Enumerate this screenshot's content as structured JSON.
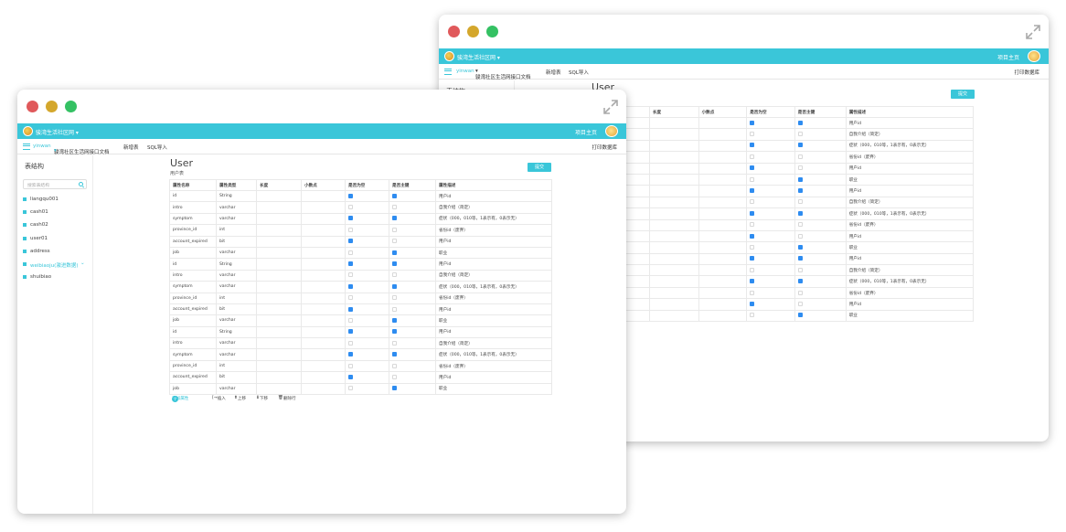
{
  "app": {
    "community": "骏湾生活社区网",
    "home": "项目主页"
  },
  "toolbar": {
    "user": "yinwan",
    "project": "骏湾社区生活网接口文档",
    "new_table": "新增表",
    "sql_import": "SQL导入",
    "print": "打印数据库"
  },
  "sidebar": {
    "title": "表结构",
    "search_placeholder": "搜索表结构",
    "items": [
      {
        "label": "liangqu001"
      },
      {
        "label": "cash01"
      },
      {
        "label": "cash02"
      },
      {
        "label": "user01"
      },
      {
        "label": "address"
      },
      {
        "label": "weibiaoju(激进数据)"
      },
      {
        "label": "shuibiao"
      }
    ]
  },
  "main": {
    "title": "User",
    "subtitle": "用户表",
    "submit": "提交",
    "columns": [
      "属性名称",
      "属性类型",
      "长度",
      "小数点",
      "是否为空",
      "是否主键",
      "属性描述"
    ],
    "rows": [
      {
        "name": "id",
        "type": "String",
        "len": "",
        "dec": "",
        "nullable": true,
        "pk": true,
        "desc": "用户id"
      },
      {
        "name": "intro",
        "type": "varchar",
        "len": "",
        "dec": "",
        "nullable": false,
        "pk": false,
        "desc": "自我介绍（简定）"
      },
      {
        "name": "symptom",
        "type": "varchar",
        "len": "",
        "dec": "",
        "nullable": true,
        "pk": true,
        "desc": "症状（000，010等，1表示有，0表示无）"
      },
      {
        "name": "province_id",
        "type": "int",
        "len": "",
        "dec": "",
        "nullable": false,
        "pk": false,
        "desc": "省份id（废弃）"
      },
      {
        "name": "account_expired",
        "type": "bit",
        "len": "",
        "dec": "",
        "nullable": true,
        "pk": false,
        "desc": "用户id"
      },
      {
        "name": "job",
        "type": "varchar",
        "len": "",
        "dec": "",
        "nullable": false,
        "pk": true,
        "desc": "职业"
      },
      {
        "name": "id",
        "type": "String",
        "len": "",
        "dec": "",
        "nullable": true,
        "pk": true,
        "desc": "用户id"
      },
      {
        "name": "intro",
        "type": "varchar",
        "len": "",
        "dec": "",
        "nullable": false,
        "pk": false,
        "desc": "自我介绍（简定）"
      },
      {
        "name": "symptom",
        "type": "varchar",
        "len": "",
        "dec": "",
        "nullable": true,
        "pk": true,
        "desc": "症状（000，010等，1表示有，0表示无）"
      },
      {
        "name": "province_id",
        "type": "int",
        "len": "",
        "dec": "",
        "nullable": false,
        "pk": false,
        "desc": "省份id（废弃）"
      },
      {
        "name": "account_expired",
        "type": "bit",
        "len": "",
        "dec": "",
        "nullable": true,
        "pk": false,
        "desc": "用户id"
      },
      {
        "name": "job",
        "type": "varchar",
        "len": "",
        "dec": "",
        "nullable": false,
        "pk": true,
        "desc": "职业"
      },
      {
        "name": "id",
        "type": "String",
        "len": "",
        "dec": "",
        "nullable": true,
        "pk": true,
        "desc": "用户id"
      },
      {
        "name": "intro",
        "type": "varchar",
        "len": "",
        "dec": "",
        "nullable": false,
        "pk": false,
        "desc": "自我介绍（简定）"
      },
      {
        "name": "symptom",
        "type": "varchar",
        "len": "",
        "dec": "",
        "nullable": true,
        "pk": true,
        "desc": "症状（000，010等，1表示有，0表示无）"
      },
      {
        "name": "province_id",
        "type": "int",
        "len": "",
        "dec": "",
        "nullable": false,
        "pk": false,
        "desc": "省份id（废弃）"
      },
      {
        "name": "account_expired",
        "type": "bit",
        "len": "",
        "dec": "",
        "nullable": true,
        "pk": false,
        "desc": "用户id"
      },
      {
        "name": "job",
        "type": "varchar",
        "len": "",
        "dec": "",
        "nullable": false,
        "pk": true,
        "desc": "职业"
      }
    ],
    "footer": {
      "add": "添加属性",
      "insert": "插入",
      "up": "上移",
      "down": "下移",
      "delete": "删除行"
    }
  },
  "colors": {
    "accent": "#3ac6d9",
    "checkbox": "#2e8cf0",
    "traffic_red": "#e0595b",
    "traffic_yellow": "#d4a72c",
    "traffic_green": "#34c163"
  }
}
